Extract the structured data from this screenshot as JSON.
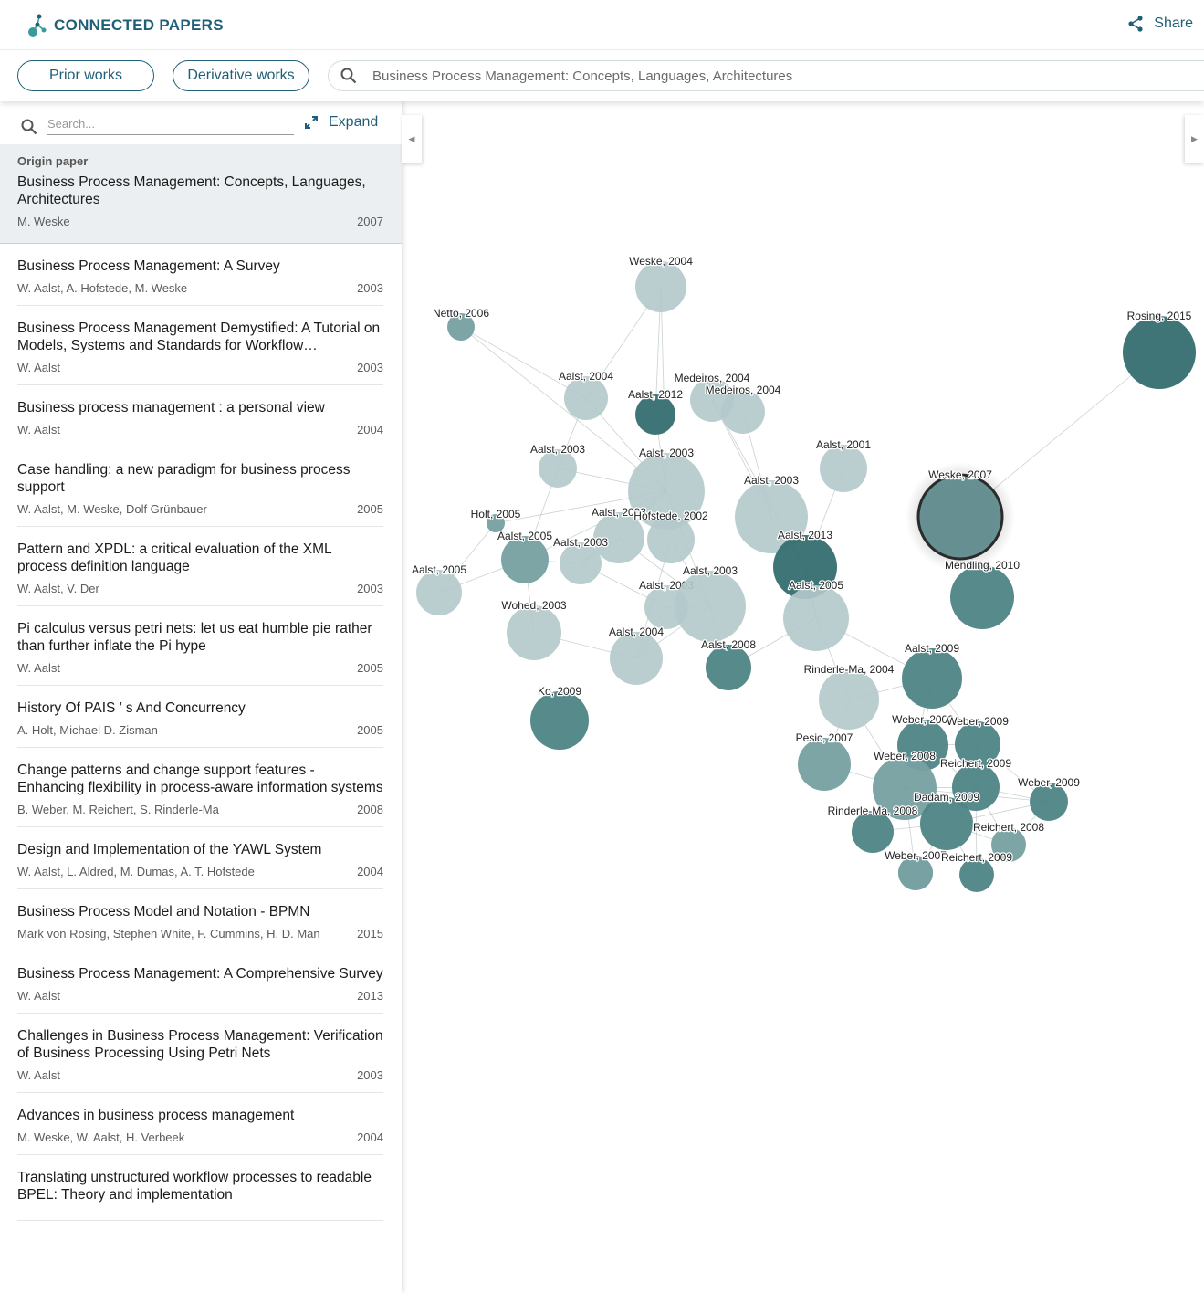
{
  "header": {
    "brand": "CONNECTED PAPERS",
    "share_label": "Share",
    "logo_icon": "connected-papers-logo",
    "share_icon": "share-icon"
  },
  "toolbar": {
    "prior_works": "Prior works",
    "derivative_works": "Derivative works",
    "search_value": "Business Process Management: Concepts, Languages, Architectures"
  },
  "sidebar": {
    "search_placeholder": "Search...",
    "expand_label": "Expand",
    "origin": {
      "label": "Origin paper",
      "title": "Business Process Management: Concepts, Languages, Architectures",
      "authors": "M. Weske",
      "year": "2007"
    },
    "papers": [
      {
        "title": "Business Process Management: A Survey",
        "authors": "W. Aalst, A. Hofstede, M. Weske",
        "year": "2003"
      },
      {
        "title": "Business Process Management Demystified: A Tutorial on Models, Systems and Standards for Workflow Management",
        "authors": "W. Aalst",
        "year": "2003"
      },
      {
        "title": "Business process management : a personal view",
        "authors": "W. Aalst",
        "year": "2004"
      },
      {
        "title": "Case handling: a new paradigm for business process support",
        "authors": "W. Aalst, M. Weske, Dolf Grünbauer",
        "year": "2005"
      },
      {
        "title": "Pattern and XPDL: a critical evaluation of the XML process definition language",
        "authors": "W. Aalst, V. Der",
        "year": "2003"
      },
      {
        "title": "Pi calculus versus petri nets: let us eat humble pie rather than further inflate the Pi hype",
        "authors": "W. Aalst",
        "year": "2005"
      },
      {
        "title": "History Of PAIS ’ s And Concurrency",
        "authors": "A. Holt, Michael D. Zisman",
        "year": "2005"
      },
      {
        "title": "Change patterns and change support features - Enhancing flexibility in process-aware information systems",
        "authors": "B. Weber, M. Reichert, S. Rinderle-Ma",
        "year": "2008"
      },
      {
        "title": "Design and Implementation of the YAWL System",
        "authors": "W. Aalst, L. Aldred, M. Dumas, A. T. Hofstede",
        "year": "2004"
      },
      {
        "title": "Business Process Model and Notation - BPMN",
        "authors": "Mark von Rosing, Stephen White, F. Cummins, H. D. Man",
        "year": "2015"
      },
      {
        "title": "Business Process Management: A Comprehensive Survey",
        "authors": "W. Aalst",
        "year": "2013"
      },
      {
        "title": "Challenges in Business Process Management: Verification of Business Processing Using Petri Nets",
        "authors": "W. Aalst",
        "year": "2003"
      },
      {
        "title": "Advances in business process management",
        "authors": "M. Weske, W. Aalst, H. Verbeek",
        "year": "2004"
      },
      {
        "title": "Translating unstructured workflow processes to readable BPEL: Theory and implementation",
        "authors": "",
        "year": ""
      }
    ]
  },
  "graph": {
    "colors": {
      "light": "#b3c9cb",
      "mid": "#77a0a1",
      "dark": "#4e8485",
      "darkest": "#356e70",
      "edge": "#8a9a9b"
    },
    "nodes": [
      {
        "label": "Weske, 2004",
        "shade": "light"
      },
      {
        "label": "Netto, 2006",
        "shade": "mid"
      },
      {
        "label": "Rosing, 2015",
        "shade": "darkest"
      },
      {
        "label": "Aalst, 2004",
        "shade": "light"
      },
      {
        "label": "Aalst, 2012",
        "shade": "darkest"
      },
      {
        "label": "Medeiros, 2004",
        "shade": "light"
      },
      {
        "label": "Medeiros, 2004",
        "shade": "light"
      },
      {
        "label": "Aalst, 2003",
        "shade": "light"
      },
      {
        "label": "Aalst, 2001",
        "shade": "light"
      },
      {
        "label": "Aalst, 2003",
        "shade": "light"
      },
      {
        "label": "Aalst, 2003",
        "shade": "light"
      },
      {
        "label": "Weske, 2007",
        "shade": "origin"
      },
      {
        "label": "Holt, 2005",
        "shade": "mid"
      },
      {
        "label": "Aalst, 2003",
        "shade": "light"
      },
      {
        "label": "Hofstede, 2002",
        "shade": "light"
      },
      {
        "label": "Aalst, 2005",
        "shade": "mid"
      },
      {
        "label": "Aalst, 2003",
        "shade": "light"
      },
      {
        "label": "Aalst, 2013",
        "shade": "darkest"
      },
      {
        "label": "Aalst, 2003",
        "shade": "light"
      },
      {
        "label": "Mendling, 2010",
        "shade": "dark"
      },
      {
        "label": "Aalst, 2003",
        "shade": "light"
      },
      {
        "label": "Aalst, 2005",
        "shade": "light"
      },
      {
        "label": "Aalst, 2005",
        "shade": "light"
      },
      {
        "label": "Wohed, 2003",
        "shade": "light"
      },
      {
        "label": "Aalst, 2004",
        "shade": "light"
      },
      {
        "label": "Aalst, 2008",
        "shade": "dark"
      },
      {
        "label": "Aalst, 2009",
        "shade": "dark"
      },
      {
        "label": "Rinderle-Ma, 2004",
        "shade": "light"
      },
      {
        "label": "Ko, 2009",
        "shade": "dark"
      },
      {
        "label": "Weber, 2007",
        "shade": "mid"
      },
      {
        "label": "Weber, 2009",
        "shade": "dark"
      },
      {
        "label": "Weber, 2009",
        "shade": "dark"
      },
      {
        "label": "Pesic, 2007",
        "shade": "mid"
      },
      {
        "label": "Weber, 2008",
        "shade": "mid"
      },
      {
        "label": "Reichert, 2009",
        "shade": "dark"
      },
      {
        "label": "Weber, 2009",
        "shade": "dark"
      },
      {
        "label": "Dadam, 2009",
        "shade": "dark"
      },
      {
        "label": "Rinderle-Ma, 2008",
        "shade": "dark"
      },
      {
        "label": "Reichert, 2008",
        "shade": "mid"
      },
      {
        "label": "Weber, 2007",
        "shade": "mid"
      },
      {
        "label": "Reichert, 2009",
        "shade": "dark"
      }
    ]
  }
}
